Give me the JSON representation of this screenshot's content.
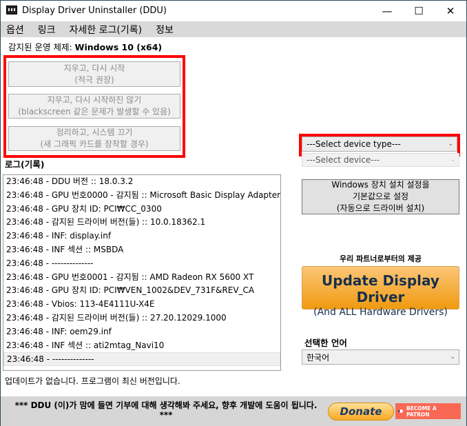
{
  "window": {
    "title": "Display Driver Uninstaller (DDU)",
    "minimize": "—",
    "maximize": "☐",
    "close": "✕"
  },
  "menu": [
    "옵션",
    "링크",
    "자세한 로그(기록)",
    "정보"
  ],
  "os": {
    "label": "감지된 운영 체제:",
    "value": "Windows 10 (x64)"
  },
  "actions": [
    {
      "line1": "지우고, 다시 시작",
      "line2": "(적극 권장)"
    },
    {
      "line1": "지우고, 다시 시작하진 않기",
      "line2": "(blackscreen 같은 문제가 발생할 수 있음)"
    },
    {
      "line1": "정리하고, 시스템 끄기",
      "line2": "(새 그래픽 카드를 장착할 경우)"
    }
  ],
  "log": {
    "label": "로그(기록)",
    "rows": [
      "23:46:48 - DDU 버전 :: 18.0.3.2",
      "23:46:48 - GPU 번호0000 - 감지됨 :: Microsoft Basic Display Adapter",
      "23:46:48 - GPU 장치 ID: PCI₩CC_0300",
      "23:46:48 - 감지된 드라이버 버전(들) :: 10.0.18362.1",
      "23:46:48 - INF: display.inf",
      "23:46:48 - INF 섹션 :: MSBDA",
      "23:46:48 - --------------",
      "23:46:48 - GPU 번호0001 - 감지됨 :: AMD Radeon RX 5600 XT",
      "23:46:48 - GPU 장치 ID: PCI₩VEN_1002&DEV_731F&REV_CA",
      "23:46:48 - Vbios: 113-4E4111U-X4E",
      "23:46:48 - 감지된 드라이버 버전(들) :: 27.20.12029.1000",
      "23:46:48 - INF: oem29.inf",
      "23:46:48 - INF 섹션 :: ati2mtag_Navi10",
      "23:46:48 - --------------"
    ]
  },
  "device_type": {
    "value": "---Select device type---"
  },
  "device": {
    "value": "---Select device---"
  },
  "windows_button": {
    "line1": "Windows 장치 설치 설정을",
    "line2": "기본값으로 설정",
    "line3": "(자동으로 드라이버 설치)"
  },
  "partner": {
    "label": "우리 파트너로부터의 제공",
    "title": "Update Display Driver",
    "subtitle": "(And ALL Hardware Drivers)"
  },
  "language": {
    "label": "선택한 언어",
    "value": "한국어"
  },
  "status": "업데이트가 없습니다.  프로그램이 최신 버전입니다.",
  "footer": {
    "line1": "*** DDU (이)가 맘에 들면 기부에 대해 생각해봐 주세요, 향후 개발에 도움이 됩니다.",
    "line2": "***",
    "donate": "Donate",
    "patron": "BECOME A PATRON"
  }
}
